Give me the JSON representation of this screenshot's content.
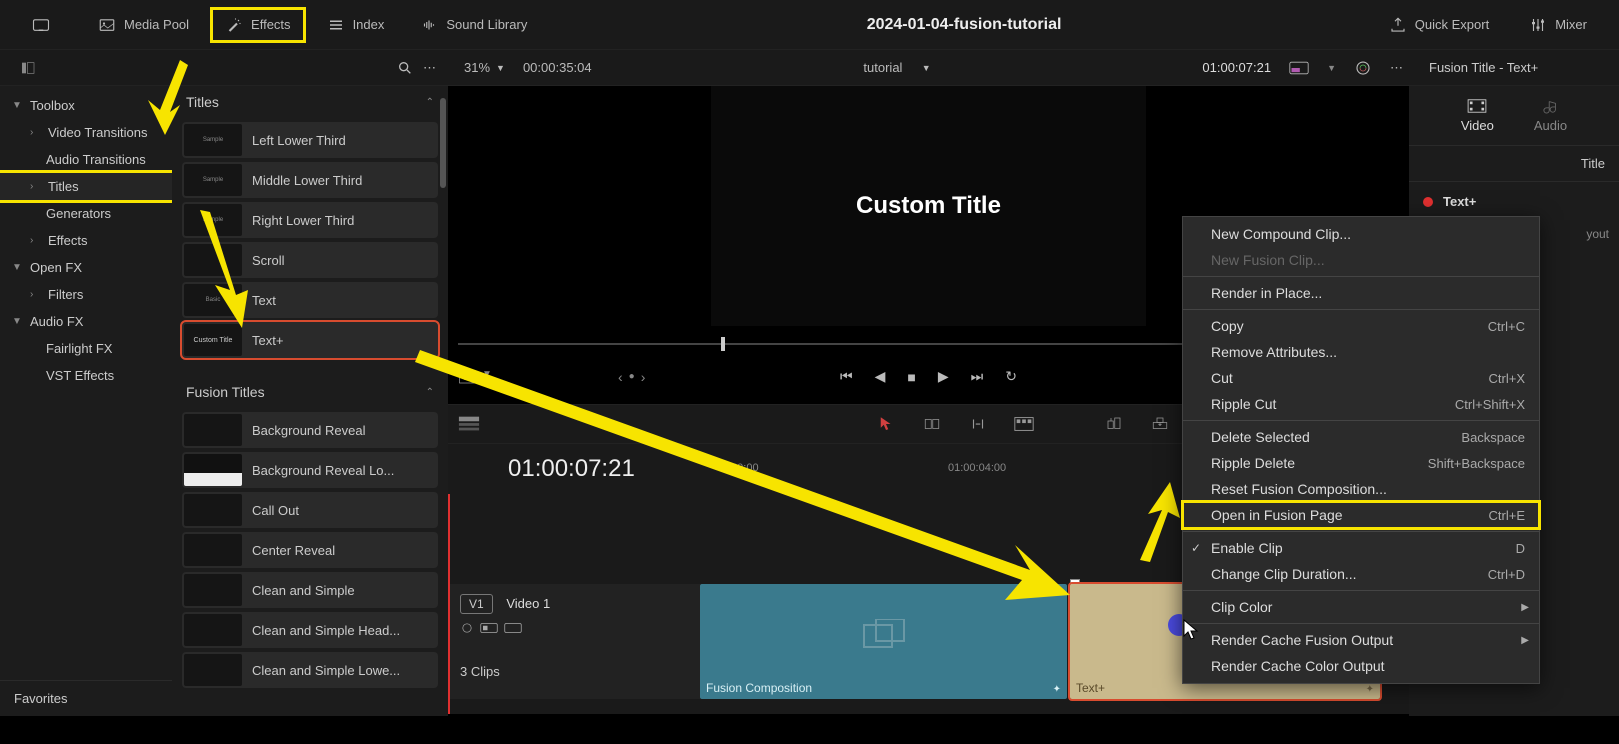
{
  "topbar": {
    "media_pool": "Media Pool",
    "effects": "Effects",
    "index": "Index",
    "sound_library": "Sound Library",
    "project_title": "2024-01-04-fusion-tutorial",
    "quick_export": "Quick Export",
    "mixer": "Mixer"
  },
  "subbar": {
    "zoom": "31%",
    "timecode_total": "00:00:35:04",
    "timeline_name": "tutorial",
    "current_tc": "01:00:07:21",
    "inspector_title": "Fusion Title - Text+"
  },
  "tree": {
    "toolbox": "Toolbox",
    "video_transitions": "Video Transitions",
    "audio_transitions": "Audio Transitions",
    "titles": "Titles",
    "generators": "Generators",
    "effects": "Effects",
    "open_fx": "Open FX",
    "filters": "Filters",
    "audio_fx": "Audio FX",
    "fairlight_fx": "Fairlight FX",
    "vst_effects": "VST Effects",
    "favorites": "Favorites"
  },
  "titles_list": {
    "header": "Titles",
    "items": [
      {
        "label": "Left Lower Third",
        "thumb": "Sample"
      },
      {
        "label": "Middle Lower Third",
        "thumb": "Sample"
      },
      {
        "label": "Right Lower Third",
        "thumb": "Sample"
      },
      {
        "label": "Scroll",
        "thumb": ""
      },
      {
        "label": "Text",
        "thumb": "Basic"
      },
      {
        "label": "Text+",
        "thumb": "Custom Title"
      }
    ]
  },
  "fusion_titles": {
    "header": "Fusion Titles",
    "items": [
      {
        "label": "Background Reveal"
      },
      {
        "label": "Background Reveal Lo..."
      },
      {
        "label": "Call Out"
      },
      {
        "label": "Center Reveal"
      },
      {
        "label": "Clean and Simple"
      },
      {
        "label": "Clean and Simple Head..."
      },
      {
        "label": "Clean and Simple Lowe..."
      }
    ]
  },
  "viewer": {
    "text": "Custom Title"
  },
  "timeline": {
    "toolbar_tc": "01:00:07:21",
    "ruler": {
      "a": ":30:00",
      "b": "01:00:04:00"
    },
    "track_label": "V1",
    "track_name": "Video 1",
    "clips_count": "3 Clips",
    "clip1": "Fusion Composition",
    "clip2": "Text+"
  },
  "inspector": {
    "video_tab": "Video",
    "audio_tab": "Audio",
    "title_section": "Title",
    "textplus": "Text+",
    "layout_tab": "yout"
  },
  "context_menu": {
    "new_compound": "New Compound Clip...",
    "new_fusion": "New Fusion Clip...",
    "render_in_place": "Render in Place...",
    "copy": "Copy",
    "copy_sc": "Ctrl+C",
    "remove_attr": "Remove Attributes...",
    "cut": "Cut",
    "cut_sc": "Ctrl+X",
    "ripple_cut": "Ripple Cut",
    "ripple_cut_sc": "Ctrl+Shift+X",
    "delete_selected": "Delete Selected",
    "delete_selected_sc": "Backspace",
    "ripple_delete": "Ripple Delete",
    "ripple_delete_sc": "Shift+Backspace",
    "reset_fusion": "Reset Fusion Composition...",
    "open_fusion": "Open in Fusion Page",
    "open_fusion_sc": "Ctrl+E",
    "enable_clip": "Enable Clip",
    "enable_clip_sc": "D",
    "change_duration": "Change Clip Duration...",
    "change_duration_sc": "Ctrl+D",
    "clip_color": "Clip Color",
    "render_cache_fusion": "Render Cache Fusion Output",
    "render_cache_color": "Render Cache Color Output"
  }
}
